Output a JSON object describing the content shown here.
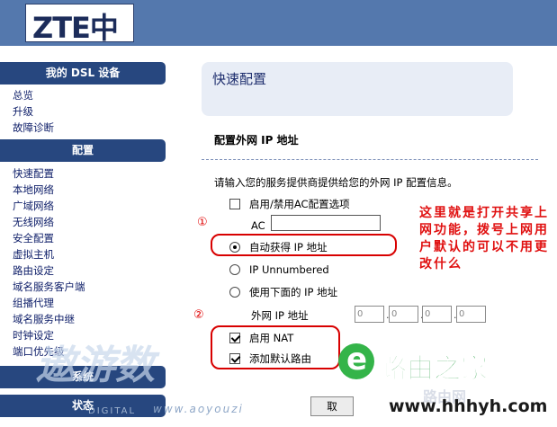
{
  "header": {
    "logo": "ZTE中兴"
  },
  "sidebar": {
    "sections": [
      {
        "title": "我的 DSL 设备",
        "items": [
          "总览",
          "升级",
          "故障诊断"
        ]
      },
      {
        "title": "配置",
        "items": [
          "快速配置",
          "本地网络",
          "广域网络",
          "无线网络",
          "安全配置",
          "虚拟主机",
          "路由设定",
          "域名服务客户端",
          "组播代理",
          "域名服务中继",
          "时钟设定",
          "端口优先级"
        ]
      },
      {
        "title": "系统",
        "items": []
      },
      {
        "title": "状态",
        "items": []
      }
    ]
  },
  "main": {
    "page_title": "快速配置",
    "section_title": "配置外网 IP 地址",
    "instruction": "请输入您的服务提供商提供给您的外网 IP 配置信息。",
    "enable_ac_label": "启用/禁用AC配置选项",
    "enable_ac_checked": false,
    "ac_label": "AC",
    "ac_value": "",
    "radio_auto_label": "自动获得 IP 地址",
    "radio_unnumbered_label": "IP Unnumbered",
    "radio_manual_label": "使用下面的 IP 地址",
    "selected_radio": "auto",
    "wan_ip_label": "外网 IP 地址",
    "wan_ip_octets": [
      "0",
      "0",
      "0",
      "0"
    ],
    "enable_nat_label": "启用 NAT",
    "enable_nat_checked": true,
    "default_route_label": "添加默认路由",
    "default_route_checked": true,
    "cancel_label": "取"
  },
  "annotations": {
    "marker_1": "①",
    "marker_2": "②",
    "note": "这里就是打开共享上网功能，拨号上网用户默认的可以不用更改什么"
  },
  "watermarks": {
    "aoyou_text": "遨游数",
    "aoyou_url": "www.aoyouzi",
    "digital": "DIGITAL",
    "brand_name": "路由之家",
    "brand_url": "www.hhhyh.com",
    "brand_ghost": "路由网"
  },
  "colors": {
    "header_bg": "#5478ad",
    "sidebar_head_bg": "#27477f",
    "annotation_red": "#e00000",
    "brand_green": "#1c9a3a"
  }
}
